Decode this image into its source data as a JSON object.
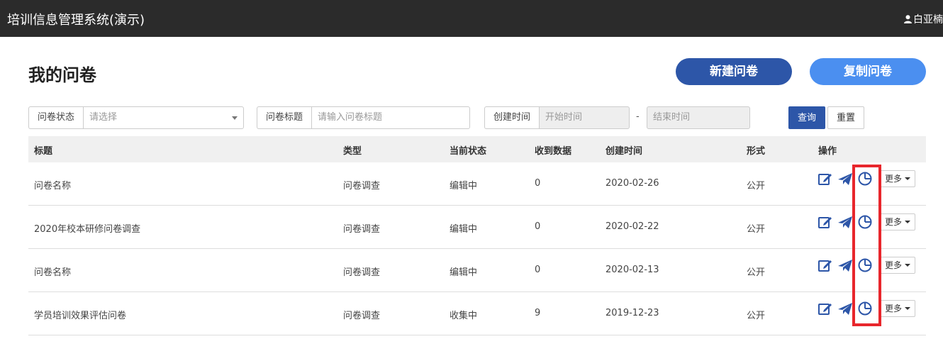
{
  "header": {
    "app_title": "培训信息管理系统(演示)",
    "user_name": "白亚楠"
  },
  "page": {
    "title": "我的问卷",
    "new_button": "新建问卷",
    "copy_button": "复制问卷"
  },
  "filters": {
    "status_label": "问卷状态",
    "status_placeholder": "请选择",
    "title_label": "问卷标题",
    "title_placeholder": "请输入问卷标题",
    "created_label": "创建时间",
    "start_placeholder": "开始时间",
    "range_separator": "-",
    "end_placeholder": "结束时间",
    "query_button": "查询",
    "reset_button": "重置"
  },
  "table": {
    "columns": [
      "标题",
      "类型",
      "当前状态",
      "收到数据",
      "创建时间",
      "形式",
      "操作"
    ],
    "rows": [
      {
        "title": "问卷名称",
        "type": "问卷调查",
        "status": "编辑中",
        "count": "0",
        "created": "2020-02-26",
        "form": "公开",
        "more": "更多"
      },
      {
        "title": "2020年校本研修问卷调查",
        "type": "问卷调查",
        "status": "编辑中",
        "count": "0",
        "created": "2020-02-22",
        "form": "公开",
        "more": "更多"
      },
      {
        "title": "问卷名称",
        "type": "问卷调查",
        "status": "编辑中",
        "count": "0",
        "created": "2020-02-13",
        "form": "公开",
        "more": "更多"
      },
      {
        "title": "学员培训效果评估问卷",
        "type": "问卷调查",
        "status": "收集中",
        "count": "9",
        "created": "2019-12-23",
        "form": "公开",
        "more": "更多"
      }
    ]
  },
  "icons": {
    "edit": "edit-icon",
    "send": "paper-plane-icon",
    "stats": "pie-chart-icon",
    "user": "user-icon"
  },
  "colors": {
    "topbar": "#2b2b2b",
    "primary": "#2d56a8",
    "secondary": "#4b8ff0",
    "highlight": "#e8262c"
  }
}
